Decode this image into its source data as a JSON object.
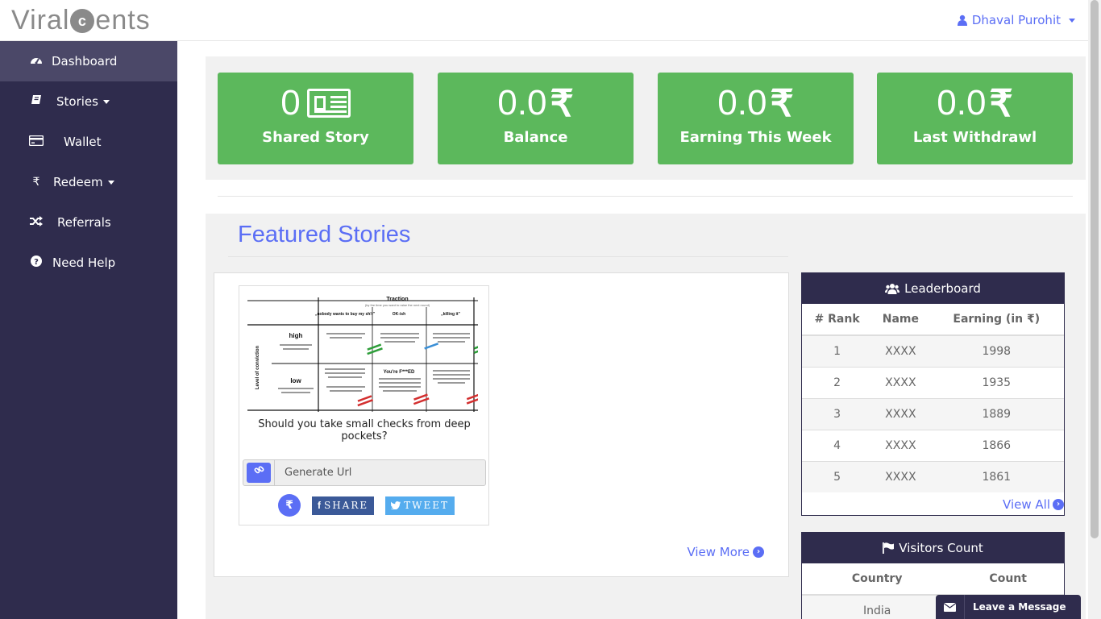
{
  "app": {
    "logo_left": "Viral",
    "logo_coin": "c",
    "logo_right": "ents"
  },
  "user": {
    "name": "Dhaval Purohit"
  },
  "sidebar": {
    "items": [
      {
        "label": "Dashboard",
        "icon": "dashboard-icon",
        "active": true
      },
      {
        "label": "Stories",
        "icon": "book-icon",
        "dropdown": true
      },
      {
        "label": "Wallet",
        "icon": "credit-card-icon"
      },
      {
        "label": "Redeem",
        "icon": "rupee-icon",
        "dropdown": true
      },
      {
        "label": "Referrals",
        "icon": "shuffle-icon"
      },
      {
        "label": "Need Help",
        "icon": "question-circle-icon"
      }
    ]
  },
  "stats": [
    {
      "value": "0",
      "label": "Shared Story",
      "icon": "newspaper-icon"
    },
    {
      "value": "0.0",
      "label": "Balance",
      "icon": "rupee-icon"
    },
    {
      "value": "0.0",
      "label": "Earning This Week",
      "icon": "rupee-icon"
    },
    {
      "value": "0.0",
      "label": "Last Withdrawl",
      "icon": "rupee-icon"
    }
  ],
  "rupee_symbol": "₹",
  "featured": {
    "title": "Featured Stories",
    "view_more": "View More",
    "story": {
      "title": "Should you take small checks from deep pockets?",
      "generate_url": "Generate Url",
      "share_label": "SHARE",
      "tweet_label": "TWEET",
      "image": {
        "heading": "Traction",
        "subheading": "(by the time you want to raise the next round)",
        "col1": "„nobody wants to buy my sh!t\"",
        "col2": "OK-ish",
        "col3": "„killing it\"",
        "row_high": "high",
        "row_low": "low",
        "axis": "Level of conviction",
        "center": "You're F***ED"
      }
    }
  },
  "leaderboard": {
    "title": "Leaderboard",
    "headers": [
      "# Rank",
      "Name",
      "Earning (in ₹)"
    ],
    "rows": [
      [
        "1",
        "XXXX",
        "1998"
      ],
      [
        "2",
        "XXXX",
        "1935"
      ],
      [
        "3",
        "XXXX",
        "1889"
      ],
      [
        "4",
        "XXXX",
        "1866"
      ],
      [
        "5",
        "XXXX",
        "1861"
      ]
    ],
    "view_all": "View All"
  },
  "visitors": {
    "title": "Visitors Count",
    "headers": [
      "Country",
      "Count"
    ],
    "rows": [
      [
        "India",
        ""
      ]
    ]
  },
  "chat": {
    "label": "Leave a Message"
  },
  "colors": {
    "sidebar": "#2f2c4d",
    "accent": "#5b6ef5",
    "stat_green": "#5cb85c"
  }
}
